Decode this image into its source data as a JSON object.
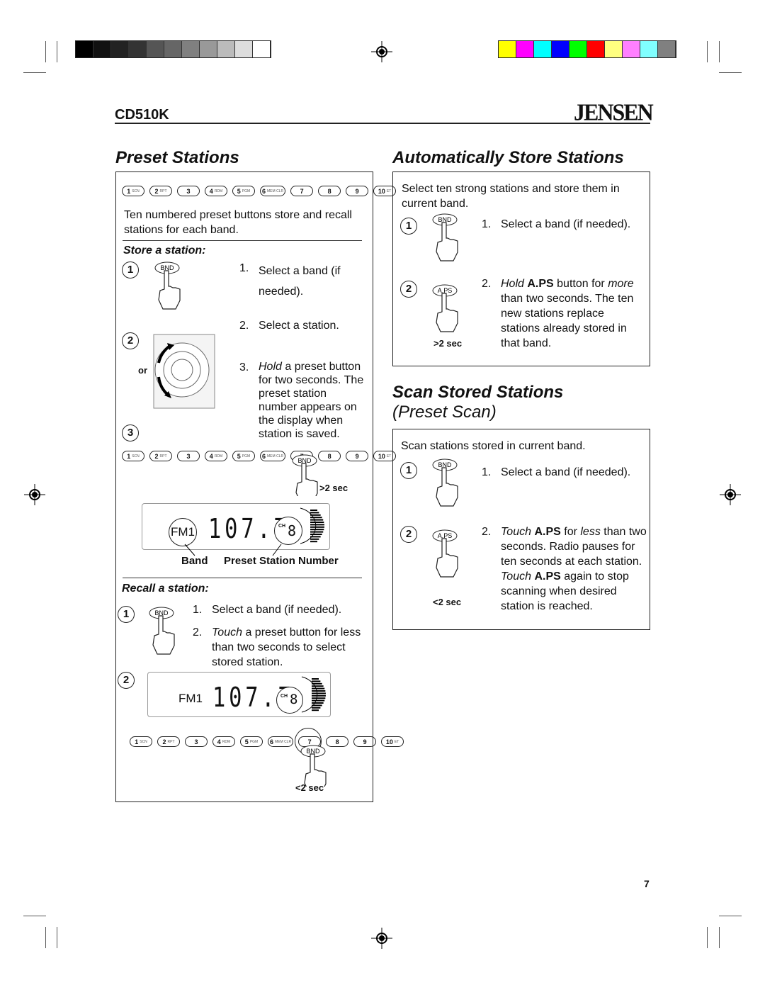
{
  "header": {
    "model": "CD510K",
    "brand": "JENSEN",
    "page_number": "7"
  },
  "colors": {
    "swatches": [
      "#ffff00",
      "#ff00ff",
      "#00ffff",
      "#0000ff",
      "#00ff00",
      "#ff0000",
      "#ffff80",
      "#ff80ff",
      "#80ffff",
      "#808080"
    ],
    "grays": [
      "#000000",
      "#111111",
      "#222222",
      "#333333",
      "#555555",
      "#666666",
      "#808080",
      "#999999",
      "#bbbbbb",
      "#dddddd",
      "#ffffff"
    ]
  },
  "preset_buttons": [
    {
      "n": "1",
      "s": "SCN"
    },
    {
      "n": "2",
      "s": "RPT"
    },
    {
      "n": "3",
      "s": ""
    },
    {
      "n": "4",
      "s": "RDM"
    },
    {
      "n": "5",
      "s": "PGM"
    },
    {
      "n": "6",
      "s": "MEM CLR"
    },
    {
      "n": "7",
      "s": ""
    },
    {
      "n": "8",
      "s": ""
    },
    {
      "n": "9",
      "s": ""
    },
    {
      "n": "10",
      "s": "ET"
    }
  ],
  "preset": {
    "title": "Preset Stations",
    "intro": "Ten numbered preset buttons store and recall stations for each band.",
    "store_heading": "Store a station:",
    "store_steps": [
      {
        "n": "1.",
        "text": "Select a band (if needed)."
      },
      {
        "n": "2.",
        "text": "Select a station."
      },
      {
        "n": "3.",
        "em": "Hold",
        "text": " a preset button for two seconds. The preset station number appears on the display when station is saved."
      }
    ],
    "or_label": "or",
    "hold_label": ">2 sec",
    "display": {
      "band": "FM1",
      "freq": "107.7",
      "ch_label": "CH",
      "ch": "8"
    },
    "band_caption": "Band",
    "preset_caption": "Preset Station Number",
    "recall_heading": "Recall a station:",
    "recall_steps": [
      {
        "n": "1.",
        "text": "Select a band (if needed)."
      },
      {
        "n": "2.",
        "em": "Touch",
        "text": " a preset button for less than two seconds to select stored station."
      }
    ],
    "touch_label": "<2 sec"
  },
  "auto": {
    "title": "Automatically Store Stations",
    "intro": "Select ten strong stations and store them in current band.",
    "step1": "Select a band (if needed).",
    "step2_em": "Hold",
    "step2_b": "A.PS",
    "step2_a": " button for ",
    "step2_em2": "more",
    "step2_c": " than two seconds. The ten new stations replace stations already stored in that band.",
    "hold_label": ">2 sec",
    "bnd": "BND",
    "aps": "A.PS"
  },
  "scan": {
    "title": "Scan Stored Stations",
    "subtitle": "(Preset Scan)",
    "intro": "Scan stations stored in current band.",
    "step1": "Select a band (if needed).",
    "step2_em": "Touch",
    "step2_b": "A.PS",
    "step2_a": " for ",
    "step2_em2": "less",
    "step2_c": " than two seconds. Radio pauses for ten seconds at each station. ",
    "step2_em3": "Touch",
    "step2_b2": "A.PS",
    "step2_d": " again to stop scanning when desired station is reached.",
    "touch_label": "<2 sec"
  },
  "step_nums": [
    "1",
    "2",
    "3"
  ]
}
